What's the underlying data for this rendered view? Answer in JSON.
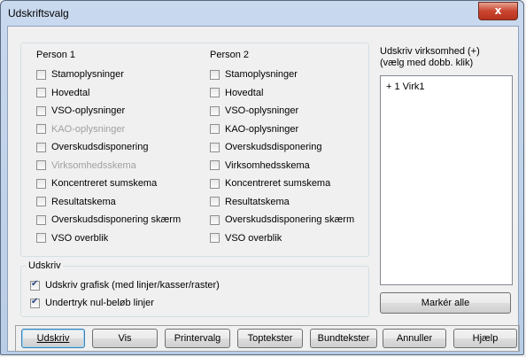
{
  "window": {
    "title": "Udskriftsvalg",
    "close_glyph": "x"
  },
  "person1": {
    "legend": "Person 1",
    "items": [
      {
        "label": "Stamoplysninger",
        "checked": false,
        "enabled": true
      },
      {
        "label": "Hovedtal",
        "checked": false,
        "enabled": true
      },
      {
        "label": "VSO-oplysninger",
        "checked": false,
        "enabled": true
      },
      {
        "label": "KAO-oplysninger",
        "checked": false,
        "enabled": false
      },
      {
        "label": "Overskudsdisponering",
        "checked": false,
        "enabled": true
      },
      {
        "label": "Virksomhedsskema",
        "checked": false,
        "enabled": false
      },
      {
        "label": "Koncentreret sumskema",
        "checked": false,
        "enabled": true
      },
      {
        "label": "Resultatskema",
        "checked": false,
        "enabled": true
      },
      {
        "label": "Overskudsdisponering skærm",
        "checked": false,
        "enabled": true
      },
      {
        "label": "VSO overblik",
        "checked": false,
        "enabled": true
      }
    ]
  },
  "person2": {
    "legend": "Person 2",
    "items": [
      {
        "label": "Stamoplysninger",
        "checked": false,
        "enabled": true
      },
      {
        "label": "Hovedtal",
        "checked": false,
        "enabled": true
      },
      {
        "label": "VSO-oplysninger",
        "checked": false,
        "enabled": true
      },
      {
        "label": "KAO-oplysninger",
        "checked": false,
        "enabled": true
      },
      {
        "label": "Overskudsdisponering",
        "checked": false,
        "enabled": true
      },
      {
        "label": "Virksomhedsskema",
        "checked": false,
        "enabled": true
      },
      {
        "label": "Koncentreret sumskema",
        "checked": false,
        "enabled": true
      },
      {
        "label": "Resultatskema",
        "checked": false,
        "enabled": true
      },
      {
        "label": "Overskudsdisponering skærm",
        "checked": false,
        "enabled": true
      },
      {
        "label": "VSO overblik",
        "checked": false,
        "enabled": true
      }
    ]
  },
  "udskriv": {
    "legend": "Udskriv",
    "items": [
      {
        "label": "Udskriv grafisk (med linjer/kasser/raster)",
        "checked": true
      },
      {
        "label": "Undertryk nul-beløb linjer",
        "checked": true
      }
    ]
  },
  "virksomhed": {
    "label_line1": "Udskriv virksomhed (+)",
    "label_line2": "(vælg med dobb. klik)",
    "items": [
      "+  1  Virk1"
    ],
    "select_all_label": "Markér alle"
  },
  "buttons": [
    "Udskriv",
    "Vis",
    "Printervalg",
    "Toptekster",
    "Bundtekster",
    "Annuller",
    "Hjælp"
  ]
}
